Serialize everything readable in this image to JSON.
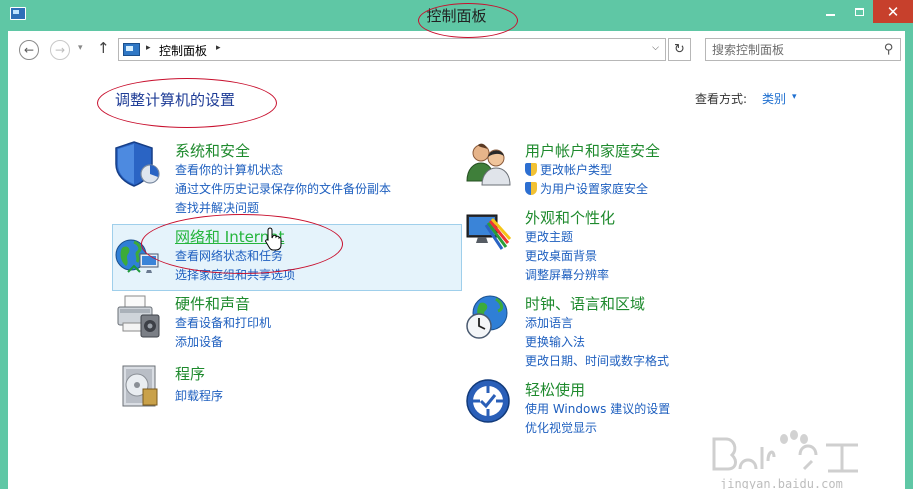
{
  "window": {
    "title": "控制面板",
    "close_glyph": "✕"
  },
  "nav": {
    "back_glyph": "←",
    "forward_glyph": "→",
    "history_glyph": "▾",
    "up_glyph": "↑",
    "address_text": "控制面板",
    "separator_glyph": "▸",
    "dropdown_glyph": "⌵",
    "refresh_glyph": "↻",
    "search_placeholder": "搜索控制面板",
    "search_glyph": "⚲"
  },
  "page": {
    "heading": "调整计算机的设置",
    "view_by_label": "查看方式:",
    "view_by_value": "类别",
    "view_by_arrow": "▾"
  },
  "categories_left": [
    {
      "title": "系统和安全",
      "icon": "shield-icon",
      "links": [
        "查看你的计算机状态",
        "通过文件历史记录保存你的文件备份副本",
        "查找并解决问题"
      ]
    },
    {
      "title": "网络和 Internet",
      "icon": "network-globe-icon",
      "links": [
        "查看网络状态和任务",
        "选择家庭组和共享选项"
      ]
    },
    {
      "title": "硬件和声音",
      "icon": "printer-icon",
      "links": [
        "查看设备和打印机",
        "添加设备"
      ]
    },
    {
      "title": "程序",
      "icon": "programs-icon",
      "links": [
        "卸载程序"
      ]
    }
  ],
  "categories_right": [
    {
      "title": "用户帐户和家庭安全",
      "icon": "users-icon",
      "links": [
        "更改帐户类型",
        "为用户设置家庭安全"
      ]
    },
    {
      "title": "外观和个性化",
      "icon": "display-icon",
      "links": [
        "更改主题",
        "更改桌面背景",
        "调整屏幕分辨率"
      ]
    },
    {
      "title": "时钟、语言和区域",
      "icon": "clock-globe-icon",
      "links": [
        "添加语言",
        "更换输入法",
        "更改日期、时间或数字格式"
      ]
    },
    {
      "title": "轻松使用",
      "icon": "ease-of-access-icon",
      "links": [
        "使用 Windows 建议的设置",
        "优化视觉显示"
      ]
    }
  ],
  "watermark": {
    "text": "jingyan.baidu.com"
  },
  "colors": {
    "title_bar": "#5fc7a5",
    "close_button": "#c7402c",
    "category_title": "#1e8a2d",
    "link": "#1e5fbf",
    "annotation": "#c8102e"
  }
}
